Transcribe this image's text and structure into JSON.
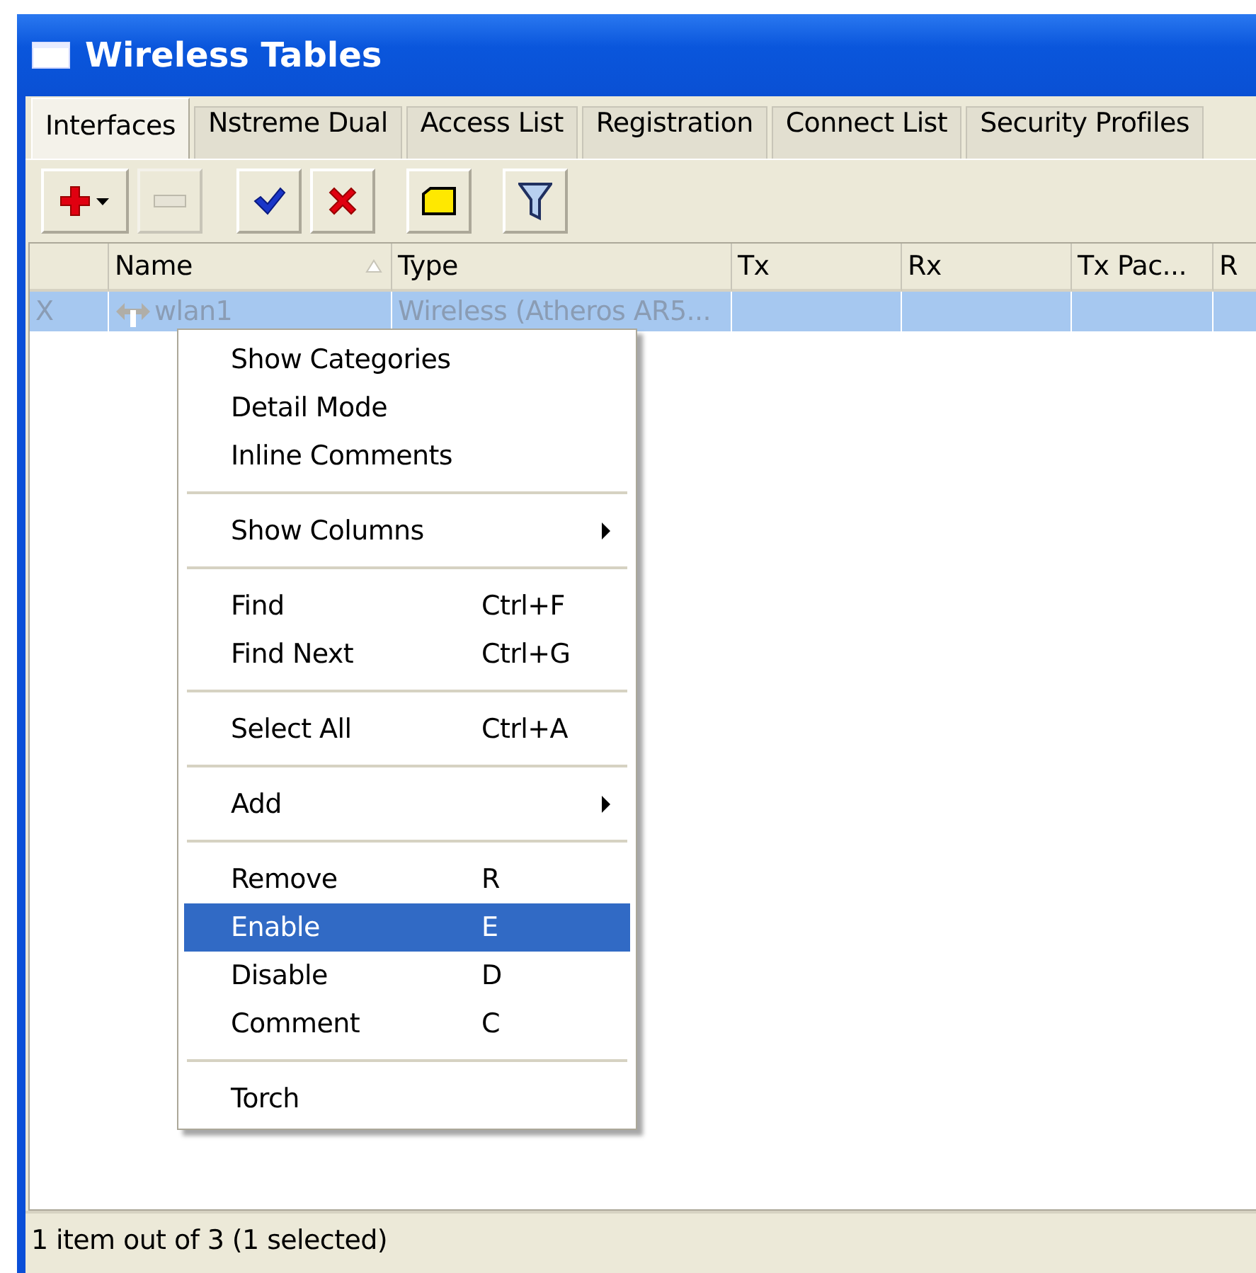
{
  "window": {
    "title": "Wireless Tables"
  },
  "tabs": [
    {
      "label": "Interfaces",
      "selected": true
    },
    {
      "label": "Nstreme Dual",
      "selected": false
    },
    {
      "label": "Access List",
      "selected": false
    },
    {
      "label": "Registration",
      "selected": false
    },
    {
      "label": "Connect List",
      "selected": false
    },
    {
      "label": "Security Profiles",
      "selected": false
    }
  ],
  "toolbar": [
    {
      "kind": "add",
      "disabled": false
    },
    {
      "kind": "remove",
      "disabled": true
    },
    {
      "kind": "enable",
      "disabled": false
    },
    {
      "kind": "disable",
      "disabled": false
    },
    {
      "kind": "comment",
      "disabled": false
    },
    {
      "kind": "filter",
      "disabled": false
    }
  ],
  "table": {
    "columns": [
      {
        "sorted": false
      },
      {
        "label": "Name",
        "sorted": true
      },
      {
        "label": "Type",
        "sorted": false
      },
      {
        "label": "Tx",
        "sorted": false
      },
      {
        "label": "Rx",
        "sorted": false
      },
      {
        "label": "Tx Pac...",
        "sorted": false
      },
      {
        "label": "R"
      }
    ],
    "rows": [
      {
        "flag": "X",
        "name": "wlan1",
        "type": "Wireless (Atheros AR5...",
        "selected": true,
        "disabled": true
      }
    ]
  },
  "context_menu": {
    "items": [
      {
        "kind": "item",
        "label": "Show Categories",
        "submenu": false,
        "selected": false
      },
      {
        "kind": "item",
        "label": "Detail Mode",
        "submenu": false,
        "selected": false
      },
      {
        "kind": "item",
        "label": "Inline Comments",
        "submenu": false,
        "selected": false
      },
      {
        "kind": "separator"
      },
      {
        "kind": "item",
        "label": "Show Columns",
        "submenu": true,
        "selected": false
      },
      {
        "kind": "separator"
      },
      {
        "kind": "item",
        "label": "Find",
        "shortcut": "Ctrl+F",
        "submenu": false,
        "selected": false
      },
      {
        "kind": "item",
        "label": "Find Next",
        "shortcut": "Ctrl+G",
        "submenu": false,
        "selected": false
      },
      {
        "kind": "separator"
      },
      {
        "kind": "item",
        "label": "Select All",
        "shortcut": "Ctrl+A",
        "submenu": false,
        "selected": false
      },
      {
        "kind": "separator"
      },
      {
        "kind": "item",
        "label": "Add",
        "submenu": true,
        "selected": false
      },
      {
        "kind": "separator"
      },
      {
        "kind": "item",
        "label": "Remove",
        "shortcut": "R",
        "submenu": false,
        "selected": false
      },
      {
        "kind": "item",
        "label": "Enable",
        "shortcut": "E",
        "submenu": false,
        "selected": true
      },
      {
        "kind": "item",
        "label": "Disable",
        "shortcut": "D",
        "submenu": false,
        "selected": false
      },
      {
        "kind": "item",
        "label": "Comment",
        "shortcut": "C",
        "submenu": false,
        "selected": false
      },
      {
        "kind": "separator"
      },
      {
        "kind": "item",
        "label": "Torch",
        "submenu": false,
        "selected": false
      }
    ]
  },
  "status_bar": "1 item out of 3 (1 selected)"
}
